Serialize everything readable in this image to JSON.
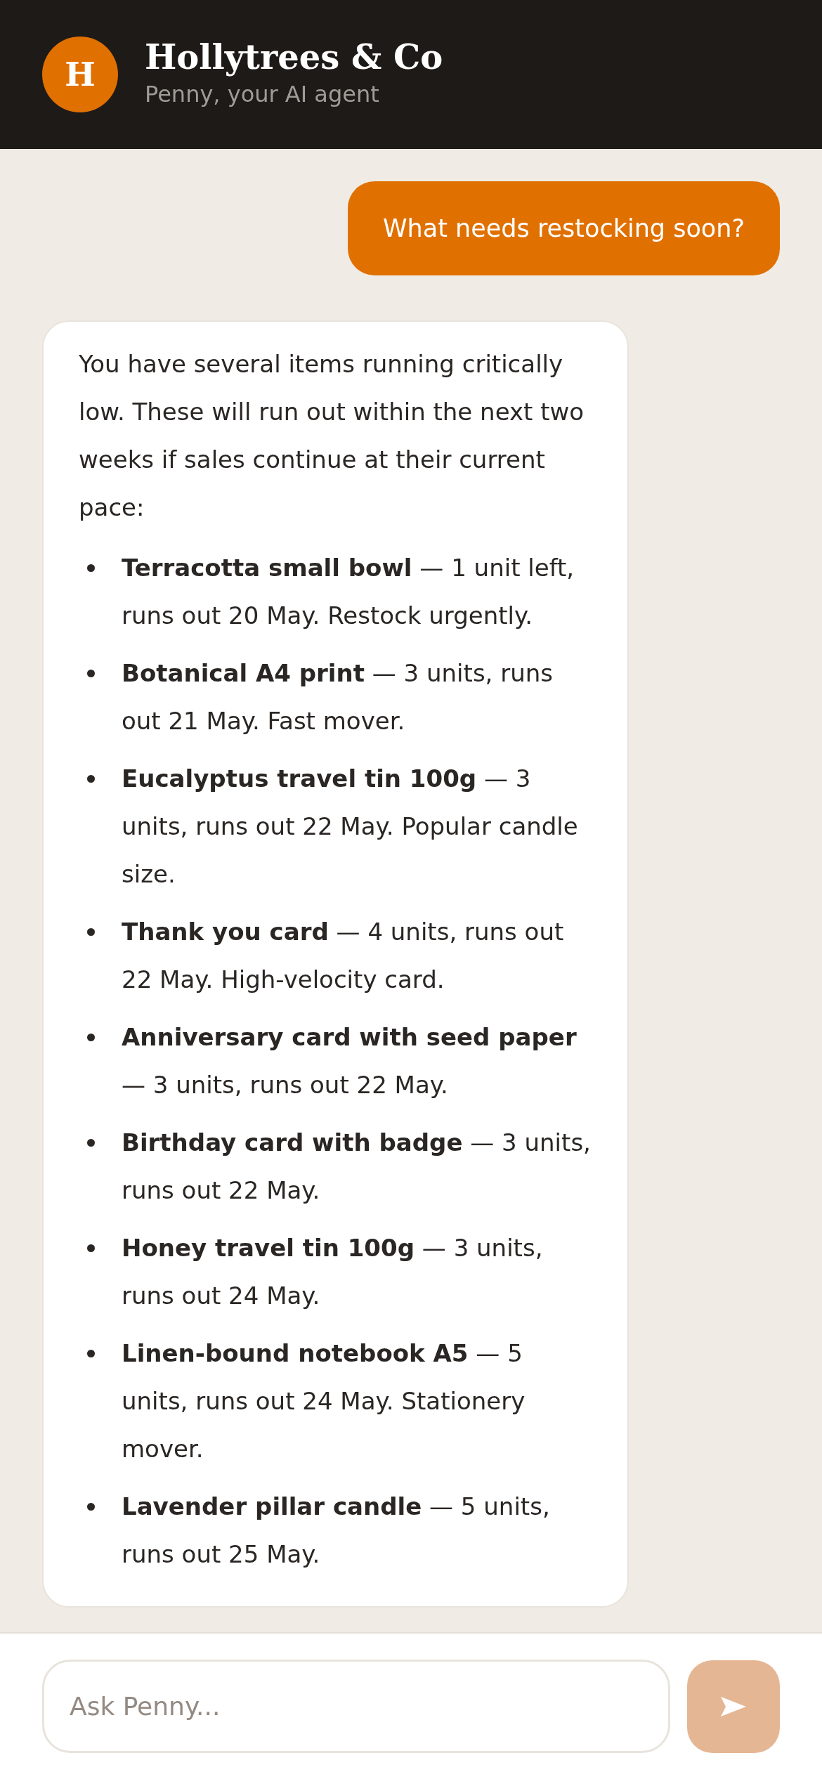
{
  "header": {
    "avatar_letter": "H",
    "title": "Hollytrees & Co",
    "subtitle": "Penny, your AI agent"
  },
  "messages": [
    {
      "kind": "user",
      "text": "What needs restocking soon?"
    },
    {
      "kind": "agent",
      "intro": "You have several items running critically low. These will run out within the next two weeks if sales continue at their current pace:",
      "items": [
        "**Terracotta small bowl** — 1 unit left, runs out 20 May. Restock urgently.",
        "**Botanical A4 print** — 3 units, runs out 21 May. Fast mover.",
        "**Eucalyptus travel tin 100g** — 3 units, runs out 22 May. Popular candle size.",
        "**Thank you card** — 4 units, runs out 22 May. High-velocity card.",
        "**Anniversary card with seed paper** — 3 units, runs out 22 May.",
        "**Birthday card with badge** — 3 units, runs out 22 May.",
        "**Honey travel tin 100g** — 3 units, runs out 24 May.",
        "**Linen-bound notebook A5** — 5 units, runs out 24 May. Stationery mover.",
        "**Lavender pillar candle** — 5 units, runs out 25 May."
      ]
    }
  ],
  "composer": {
    "placeholder": "Ask Penny...",
    "send_disabled": true
  }
}
